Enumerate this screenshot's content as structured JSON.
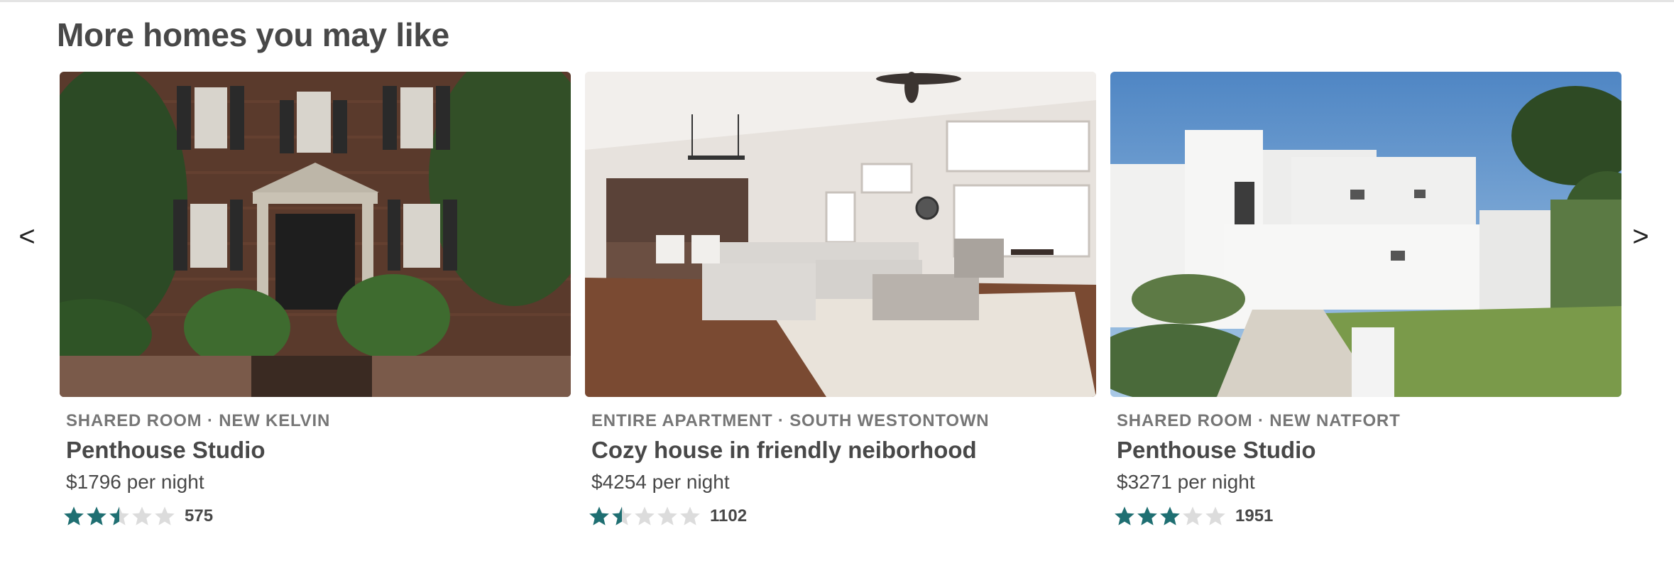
{
  "section": {
    "title": "More homes you may like"
  },
  "carousel": {
    "prev_label": "<",
    "next_label": ">"
  },
  "listings": [
    {
      "meta": "SHARED ROOM · NEW KELVIN",
      "title": "Penthouse Studio",
      "price": "$1796 per night",
      "rating": 2.5,
      "reviews": "575",
      "photo": "brick-townhouse-photo"
    },
    {
      "meta": "ENTIRE APARTMENT · SOUTH WESTONTOWN",
      "title": "Cozy house in friendly neiborhood",
      "price": "$4254 per night",
      "rating": 1.5,
      "reviews": "1102",
      "photo": "living-room-photo"
    },
    {
      "meta": "SHARED ROOM · NEW NATFORT",
      "title": "Penthouse Studio",
      "price": "$3271 per night",
      "rating": 3,
      "reviews": "1951",
      "photo": "white-villa-photo"
    }
  ],
  "colors": {
    "star_filled": "#1f6f72",
    "star_empty": "#dcdcdc"
  }
}
